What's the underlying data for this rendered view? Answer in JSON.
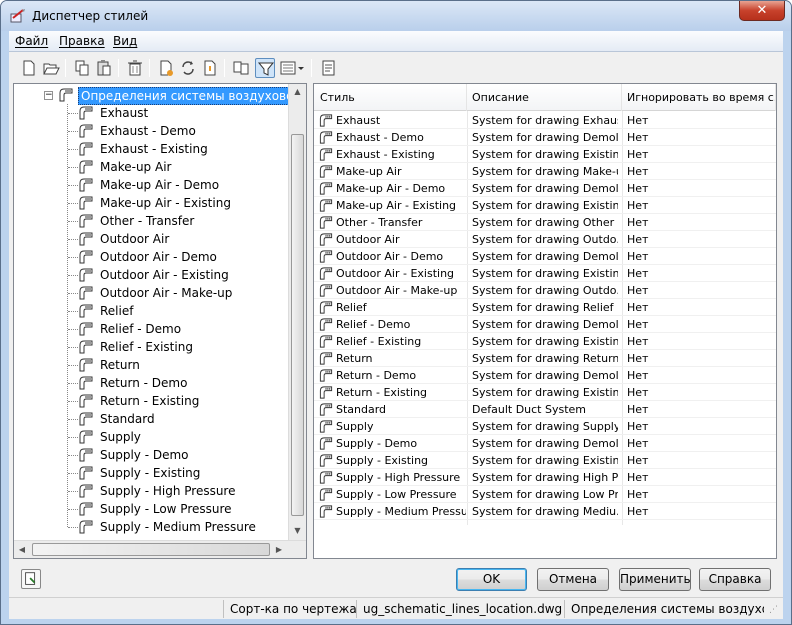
{
  "window": {
    "title": "Диспетчер стилей",
    "close_glyph": "✕"
  },
  "menu": [
    "Файл",
    "Правка",
    "Вид"
  ],
  "toolbar_icons": [
    "new-icon",
    "open-icon",
    "copy-icon",
    "paste-icon",
    "purge-icon",
    "edit-style-icon",
    "sync-icon",
    "set-from-icon",
    "toggle-view-icon",
    "filter-icon",
    "display-options-icon",
    "dropdown-arrow-icon",
    "properties-icon"
  ],
  "tree": {
    "root": "Определения системы воздуховодов",
    "items": [
      "Exhaust",
      "Exhaust - Demo",
      "Exhaust - Existing",
      "Make-up Air",
      "Make-up Air - Demo",
      "Make-up Air - Existing",
      "Other - Transfer",
      "Outdoor Air",
      "Outdoor Air - Demo",
      "Outdoor Air - Existing",
      "Outdoor Air - Make-up",
      "Relief",
      "Relief - Demo",
      "Relief - Existing",
      "Return",
      "Return - Demo",
      "Return - Existing",
      "Standard",
      "Supply",
      "Supply - Demo",
      "Supply - Existing",
      "Supply - High Pressure",
      "Supply - Low Pressure",
      "Supply - Medium Pressure"
    ]
  },
  "list": {
    "headers": [
      "Стиль",
      "Описание",
      "Игнорировать во время с..."
    ],
    "rows": [
      [
        "Exhaust",
        "System for drawing Exhaus...",
        "Нет"
      ],
      [
        "Exhaust - Demo",
        "System for drawing Demoli...",
        "Нет"
      ],
      [
        "Exhaust - Existing",
        "System for drawing Existin...",
        "Нет"
      ],
      [
        "Make-up Air",
        "System for drawing Make-u...",
        "Нет"
      ],
      [
        "Make-up Air - Demo",
        "System for drawing Demoli...",
        "Нет"
      ],
      [
        "Make-up Air - Existing",
        "System for drawing Existin...",
        "Нет"
      ],
      [
        "Other - Transfer",
        "System for drawing Other ...",
        "Нет"
      ],
      [
        "Outdoor Air",
        "System for drawing Outdo...",
        "Нет"
      ],
      [
        "Outdoor Air - Demo",
        "System for drawing Demoli...",
        "Нет"
      ],
      [
        "Outdoor Air - Existing",
        "System for drawing Existin...",
        "Нет"
      ],
      [
        "Outdoor Air - Make-up",
        "System for drawing Outdo...",
        "Нет"
      ],
      [
        "Relief",
        "System for drawing Relief ...",
        "Нет"
      ],
      [
        "Relief - Demo",
        "System for drawing Demoli...",
        "Нет"
      ],
      [
        "Relief - Existing",
        "System for drawing Existin...",
        "Нет"
      ],
      [
        "Return",
        "System for drawing Return...",
        "Нет"
      ],
      [
        "Return - Demo",
        "System for drawing Demoli...",
        "Нет"
      ],
      [
        "Return - Existing",
        "System for drawing Existin...",
        "Нет"
      ],
      [
        "Standard",
        "Default Duct System",
        "Нет"
      ],
      [
        "Supply",
        "System for drawing Supply ...",
        "Нет"
      ],
      [
        "Supply - Demo",
        "System for drawing Demoli...",
        "Нет"
      ],
      [
        "Supply - Existing",
        "System for drawing Existin...",
        "Нет"
      ],
      [
        "Supply - High Pressure",
        "System for drawing High Pr...",
        "Нет"
      ],
      [
        "Supply - Low Pressure",
        "System for drawing Low Pr...",
        "Нет"
      ],
      [
        "Supply - Medium Pressure",
        "System for drawing Mediu...",
        "Нет"
      ]
    ]
  },
  "buttons": {
    "ok": "OK",
    "cancel": "Отмена",
    "apply": "Применить",
    "help": "Справка"
  },
  "status": {
    "sort": "Сорт-ка по чертежам",
    "file": "ug_schematic_lines_location.dwg",
    "category": "Определения системы воздуховод"
  },
  "colors": {
    "selection": "#3399ff",
    "accent": "#48b6f0"
  }
}
